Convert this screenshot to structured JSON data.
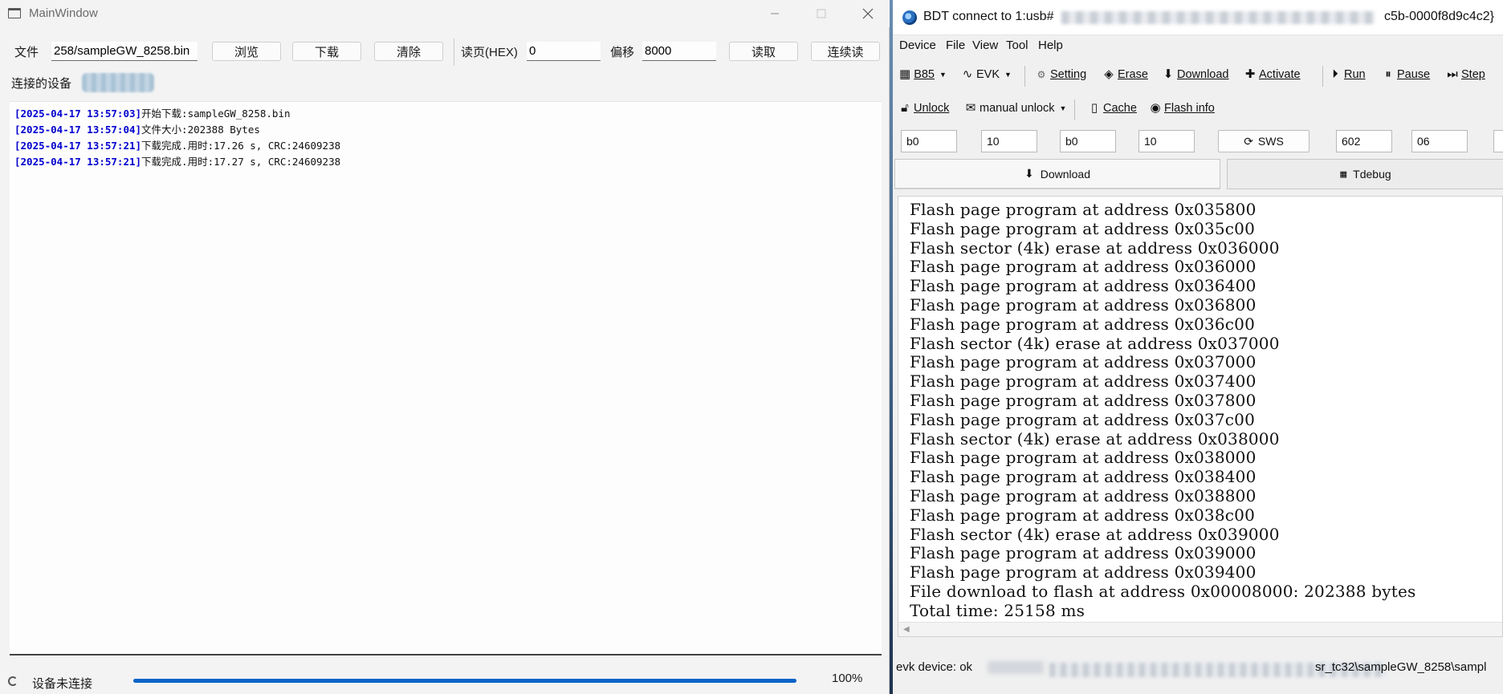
{
  "main_window": {
    "title": "MainWindow",
    "file_label": "文件",
    "file_path": "258/sampleGW_8258.bin",
    "browse_label": "浏览",
    "download_label": "下载",
    "clear_label": "清除",
    "read_page_label": "读页(HEX)",
    "read_page_value": "0",
    "offset_label": "偏移",
    "offset_value": "8000",
    "read_label": "读取",
    "continuous_read_label": "连续读",
    "connected_devices_label": "连接的设备",
    "log": [
      {
        "ts": "[2025-04-17 13:57:03]",
        "msg": "开始下载:sampleGW_8258.bin"
      },
      {
        "ts": "[2025-04-17 13:57:04]",
        "msg": "文件大小:202388 Bytes"
      },
      {
        "ts": "[2025-04-17 13:57:21]",
        "msg": "下载完成.用时:17.26 s, CRC:24609238"
      },
      {
        "ts": "[2025-04-17 13:57:21]",
        "msg": "下载完成.用时:17.27 s, CRC:24609238"
      }
    ],
    "status_text": "设备未连接",
    "progress": 1.0,
    "progress_text": "100%"
  },
  "bdt_window": {
    "title_prefix": "BDT connect to 1:usb#",
    "title_suffix": "c5b-0000f8d9c4c2}",
    "menu": [
      "Device",
      "File",
      "View",
      "Tool",
      "Help"
    ],
    "toolbar1": {
      "chip": "B85",
      "board": "EVK",
      "setting": "Setting",
      "erase": "Erase",
      "download": "Download",
      "activate": "Activate",
      "run": "Run",
      "pause": "Pause",
      "step": "Step"
    },
    "toolbar2": {
      "unlock": "Unlock",
      "manual_unlock": "manual unlock",
      "cache": "Cache",
      "flash_info": "Flash info"
    },
    "params": [
      "b0",
      "10",
      "b0",
      "10",
      "602",
      "06"
    ],
    "sws_label": "SWS",
    "tabs": [
      "Download",
      "Tdebug"
    ],
    "console_lines": [
      "Flash page program at address 0x035800",
      "Flash page program at address 0x035c00",
      "Flash sector (4k) erase at address 0x036000",
      "Flash page program at address 0x036000",
      "Flash page program at address 0x036400",
      "Flash page program at address 0x036800",
      "Flash page program at address 0x036c00",
      "Flash sector (4k) erase at address 0x037000",
      "Flash page program at address 0x037000",
      "Flash page program at address 0x037400",
      "Flash page program at address 0x037800",
      "Flash page program at address 0x037c00",
      "Flash sector (4k) erase at address 0x038000",
      "Flash page program at address 0x038000",
      "Flash page program at address 0x038400",
      "Flash page program at address 0x038800",
      "Flash page program at address 0x038c00",
      "Flash sector (4k) erase at address 0x039000",
      "Flash page program at address 0x039000",
      "Flash page program at address 0x039400",
      "File download to flash at address 0x00008000: 202388 bytes",
      "Total time: 25158 ms"
    ],
    "status_device": "evk device: ok",
    "status_path": "sr_tc32\\sampleGW_8258\\sampl"
  }
}
